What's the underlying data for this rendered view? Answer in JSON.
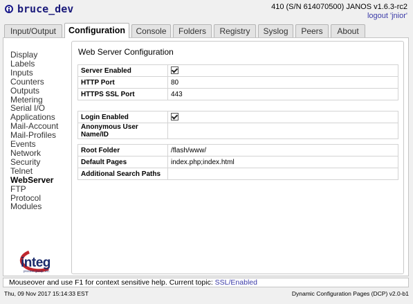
{
  "header": {
    "title": "bruce_dev",
    "version": "410 (S/N 614070500) JANOS v1.6.3-rc2",
    "logout": "logout 'jnior'"
  },
  "tabs": [
    "Input/Output",
    "Configuration",
    "Console",
    "Folders",
    "Registry",
    "Syslog",
    "Peers",
    "About"
  ],
  "active_tab": "Configuration",
  "sidebar": {
    "items": [
      "Display",
      "Labels",
      "Inputs",
      "Counters",
      "Outputs",
      "Metering",
      "Serial I/O",
      "Applications",
      "Mail-Account",
      "Mail-Profiles",
      "Events",
      "Network",
      "Security",
      "Telnet",
      "WebServer",
      "FTP",
      "Protocol",
      "Modules"
    ],
    "active": "WebServer"
  },
  "logo": {
    "text": "integ",
    "subtext": "process group, inc."
  },
  "panel": {
    "title": "Web Server Configuration",
    "group1": [
      {
        "label": "Server Enabled",
        "checkbox": true,
        "value": ""
      },
      {
        "label": "HTTP Port",
        "value": "80"
      },
      {
        "label": "HTTPS SSL Port",
        "value": "443"
      }
    ],
    "group2": [
      {
        "label": "Login Enabled",
        "checkbox": true,
        "value": ""
      },
      {
        "label": "Anonymous User Name/ID",
        "value": ""
      }
    ],
    "group3": [
      {
        "label": "Root Folder",
        "value": "/flash/www/"
      },
      {
        "label": "Default Pages",
        "value": "index.php;index.html"
      },
      {
        "label": "Additional Search Paths",
        "value": ""
      }
    ]
  },
  "footer": {
    "help_text": "Mouseover and use F1 for context sensitive help.  Current topic: ",
    "help_link": "SSL/Enabled",
    "datetime": "Thu, 09 Nov 2017 15:14:33 EST",
    "dcp_version": "Dynamic Configuration Pages (DCP) v2.0-b1"
  },
  "colors": {
    "title": "#1a1a7a",
    "link": "#3a3aa8",
    "logo_red": "#c0262d",
    "logo_blue": "#1b2a6b"
  }
}
